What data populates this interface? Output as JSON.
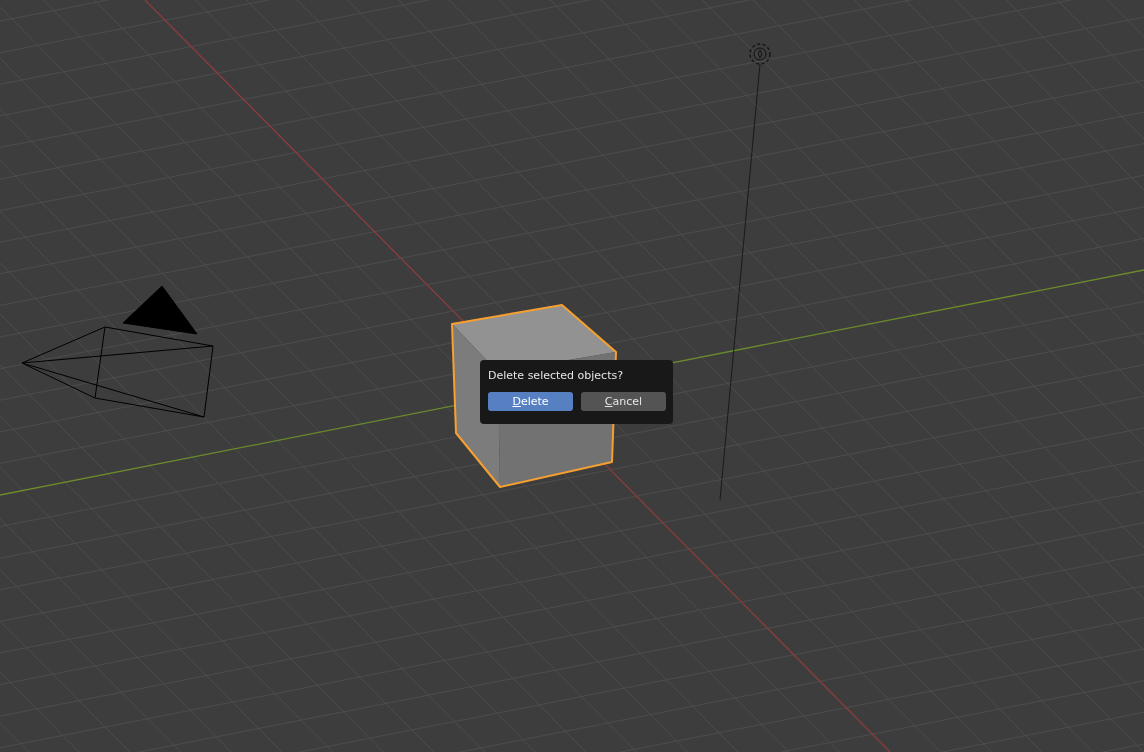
{
  "scene": {
    "objects": [
      {
        "kind": "camera",
        "selected": false
      },
      {
        "kind": "light",
        "selected": false
      },
      {
        "kind": "cube",
        "selected": true
      }
    ]
  },
  "dialog": {
    "message": "Delete selected objects?",
    "buttons": [
      {
        "label": "Delete",
        "selected": true
      },
      {
        "label": "Cancel",
        "selected": false
      }
    ]
  }
}
